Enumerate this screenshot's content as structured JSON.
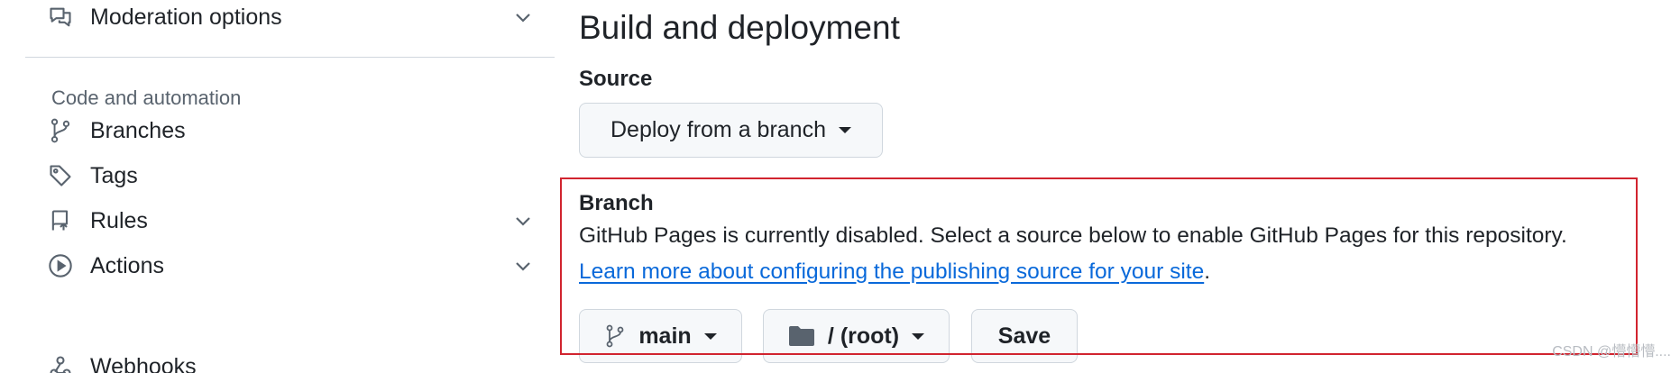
{
  "sidebar": {
    "items": [
      {
        "label": "Moderation options",
        "icon": "comment-discussion-icon",
        "expandable": true
      },
      {
        "label": "Branches",
        "icon": "git-branch-icon",
        "expandable": false
      },
      {
        "label": "Tags",
        "icon": "tag-icon",
        "expandable": false
      },
      {
        "label": "Rules",
        "icon": "repo-push-icon",
        "expandable": true
      },
      {
        "label": "Actions",
        "icon": "play-icon",
        "expandable": true
      },
      {
        "label": "Webhooks",
        "icon": "webhook-icon",
        "expandable": false
      }
    ],
    "section_title": "Code and automation"
  },
  "main": {
    "heading": "Build and deployment",
    "source": {
      "label": "Source",
      "selected": "Deploy from a branch"
    },
    "branch": {
      "label": "Branch",
      "description": "GitHub Pages is currently disabled. Select a source below to enable GitHub Pages for this repository.",
      "link_text": "Learn more about configuring the publishing source for your site",
      "link_suffix": ".",
      "branch_select": "main",
      "folder_select": "/ (root)",
      "save_label": "Save"
    }
  },
  "watermark": "CSDN @懵懵懵....",
  "colors": {
    "link": "#0969da",
    "highlight_border": "#d1242f",
    "button_bg": "#f6f8fa",
    "border": "#d0d7de",
    "muted_text": "#59636e"
  }
}
